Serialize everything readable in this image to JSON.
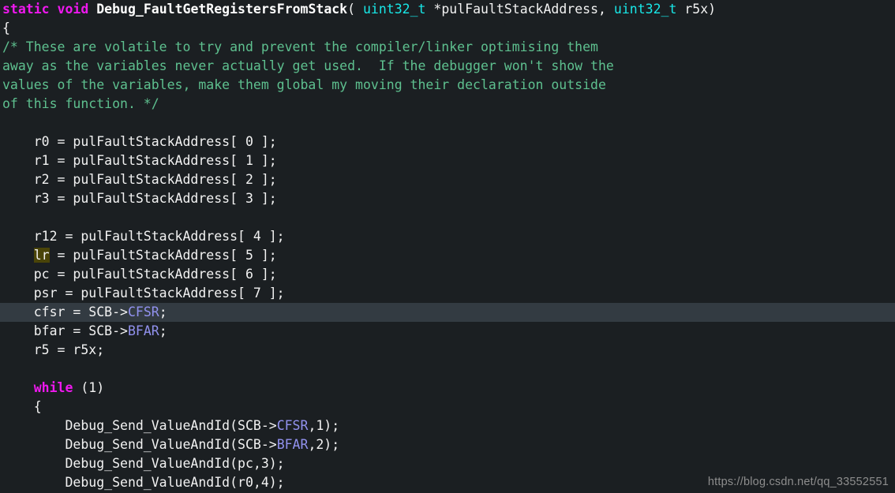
{
  "editor": {
    "background_color": "#1b1f22",
    "default_text_color": "#f2f2f2",
    "current_line_color": "#333b42",
    "word_highlight_color": "#4a4408",
    "colors": {
      "keyword": "#ef18ef",
      "type": "#18e8e8",
      "comment": "#5ec08f",
      "member": "#9292ef",
      "plain": "#f2f2f2"
    }
  },
  "code": {
    "line1": {
      "kw_static": "static",
      "sp1": " ",
      "kw_void": "void",
      "sp2": " ",
      "fn_name": "Debug_FaultGetRegistersFromStack",
      "paren_open": "( ",
      "type1": "uint32_t",
      "param1": " *pulFaultStackAddress, ",
      "type2": "uint32_t",
      "param2": " r5x)"
    },
    "line2": "{",
    "comment_l1": "/* These are volatile to try and prevent the compiler/linker optimising them",
    "comment_l2": "away as the variables never actually get used.  If the debugger won't show the",
    "comment_l3": "values of the variables, make them global my moving their declaration outside",
    "comment_l4": "of this function. */",
    "blank1": "",
    "r0": "    r0 = pulFaultStackAddress[ 0 ];",
    "r1": "    r1 = pulFaultStackAddress[ 1 ];",
    "r2": "    r2 = pulFaultStackAddress[ 2 ];",
    "r3": "    r3 = pulFaultStackAddress[ 3 ];",
    "blank2": "",
    "r12": "    r12 = pulFaultStackAddress[ 4 ];",
    "lr_indent": "    ",
    "lr_word": "lr",
    "lr_rest": " = pulFaultStackAddress[ 5 ];",
    "pc": "    pc = pulFaultStackAddress[ 6 ];",
    "psr": "    psr = pulFaultStackAddress[ 7 ];",
    "cfsr_pre": "    cfsr = SCB->",
    "cfsr_member": "CFSR",
    "cfsr_post": ";",
    "bfar_pre": "    bfar = SCB->",
    "bfar_member": "BFAR",
    "bfar_post": ";",
    "r5": "    r5 = r5x;",
    "blank3": "",
    "while_indent": "    ",
    "while_kw": "while",
    "while_cond": " (1)",
    "brace_open": "    {",
    "send_cfsr_pre": "        Debug_Send_ValueAndId(SCB->",
    "send_cfsr_member": "CFSR",
    "send_cfsr_post": ",1);",
    "send_bfar_pre": "        Debug_Send_ValueAndId(SCB->",
    "send_bfar_member": "BFAR",
    "send_bfar_post": ",2);",
    "send_pc": "        Debug_Send_ValueAndId(pc,3);",
    "send_r0": "        Debug_Send_ValueAndId(r0,4);"
  },
  "watermark": {
    "text": "https://blog.csdn.net/qq_33552551"
  }
}
